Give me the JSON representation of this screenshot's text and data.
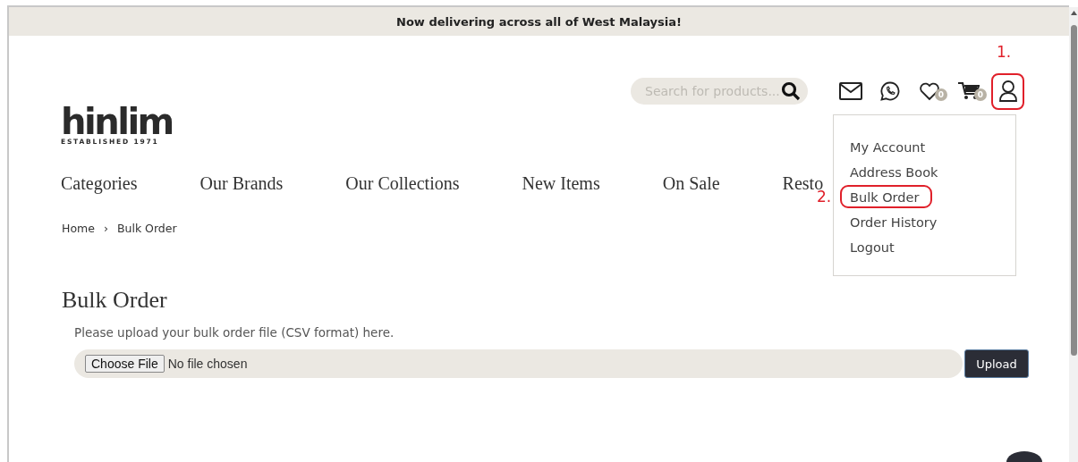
{
  "announcement": "Now delivering across all of West Malaysia!",
  "logo": {
    "name": "hinlim",
    "tagline": "ESTABLISHED 1971"
  },
  "search": {
    "placeholder": "Search for products..."
  },
  "header_icons": [
    {
      "kind": "mail"
    },
    {
      "kind": "chat"
    },
    {
      "kind": "wishlist",
      "count": "0"
    },
    {
      "kind": "cart",
      "count": "0"
    },
    {
      "kind": "account",
      "annotation": "1."
    }
  ],
  "account_menu": [
    {
      "label": "My Account"
    },
    {
      "label": "Address Book"
    },
    {
      "label": "Bulk Order",
      "annotation": "2."
    },
    {
      "label": "Order History"
    },
    {
      "label": "Logout"
    }
  ],
  "nav": [
    "Categories",
    "Our Brands",
    "Our Collections",
    "New Items",
    "On Sale",
    "Resto"
  ],
  "breadcrumb": {
    "items": [
      "Home",
      "Bulk Order"
    ],
    "separator": "›"
  },
  "page_title": "Bulk Order",
  "instructions": "Please upload your bulk order file (CSV format) here.",
  "file_input": {
    "button": "Choose File",
    "status": "No file chosen"
  },
  "upload_button": "Upload"
}
